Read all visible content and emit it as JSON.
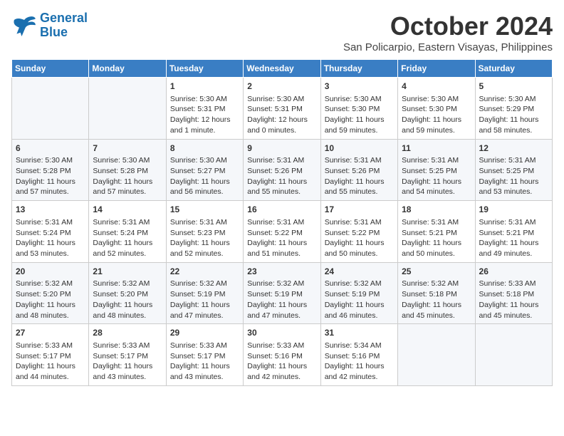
{
  "logo": {
    "line1": "General",
    "line2": "Blue"
  },
  "title": "October 2024",
  "subtitle": "San Policarpio, Eastern Visayas, Philippines",
  "weekdays": [
    "Sunday",
    "Monday",
    "Tuesday",
    "Wednesday",
    "Thursday",
    "Friday",
    "Saturday"
  ],
  "weeks": [
    [
      {
        "day": null,
        "info": null
      },
      {
        "day": null,
        "info": null
      },
      {
        "day": "1",
        "info": "Sunrise: 5:30 AM\nSunset: 5:31 PM\nDaylight: 12 hours\nand 1 minute."
      },
      {
        "day": "2",
        "info": "Sunrise: 5:30 AM\nSunset: 5:31 PM\nDaylight: 12 hours\nand 0 minutes."
      },
      {
        "day": "3",
        "info": "Sunrise: 5:30 AM\nSunset: 5:30 PM\nDaylight: 11 hours\nand 59 minutes."
      },
      {
        "day": "4",
        "info": "Sunrise: 5:30 AM\nSunset: 5:30 PM\nDaylight: 11 hours\nand 59 minutes."
      },
      {
        "day": "5",
        "info": "Sunrise: 5:30 AM\nSunset: 5:29 PM\nDaylight: 11 hours\nand 58 minutes."
      }
    ],
    [
      {
        "day": "6",
        "info": "Sunrise: 5:30 AM\nSunset: 5:28 PM\nDaylight: 11 hours\nand 57 minutes."
      },
      {
        "day": "7",
        "info": "Sunrise: 5:30 AM\nSunset: 5:28 PM\nDaylight: 11 hours\nand 57 minutes."
      },
      {
        "day": "8",
        "info": "Sunrise: 5:30 AM\nSunset: 5:27 PM\nDaylight: 11 hours\nand 56 minutes."
      },
      {
        "day": "9",
        "info": "Sunrise: 5:31 AM\nSunset: 5:26 PM\nDaylight: 11 hours\nand 55 minutes."
      },
      {
        "day": "10",
        "info": "Sunrise: 5:31 AM\nSunset: 5:26 PM\nDaylight: 11 hours\nand 55 minutes."
      },
      {
        "day": "11",
        "info": "Sunrise: 5:31 AM\nSunset: 5:25 PM\nDaylight: 11 hours\nand 54 minutes."
      },
      {
        "day": "12",
        "info": "Sunrise: 5:31 AM\nSunset: 5:25 PM\nDaylight: 11 hours\nand 53 minutes."
      }
    ],
    [
      {
        "day": "13",
        "info": "Sunrise: 5:31 AM\nSunset: 5:24 PM\nDaylight: 11 hours\nand 53 minutes."
      },
      {
        "day": "14",
        "info": "Sunrise: 5:31 AM\nSunset: 5:24 PM\nDaylight: 11 hours\nand 52 minutes."
      },
      {
        "day": "15",
        "info": "Sunrise: 5:31 AM\nSunset: 5:23 PM\nDaylight: 11 hours\nand 52 minutes."
      },
      {
        "day": "16",
        "info": "Sunrise: 5:31 AM\nSunset: 5:22 PM\nDaylight: 11 hours\nand 51 minutes."
      },
      {
        "day": "17",
        "info": "Sunrise: 5:31 AM\nSunset: 5:22 PM\nDaylight: 11 hours\nand 50 minutes."
      },
      {
        "day": "18",
        "info": "Sunrise: 5:31 AM\nSunset: 5:21 PM\nDaylight: 11 hours\nand 50 minutes."
      },
      {
        "day": "19",
        "info": "Sunrise: 5:31 AM\nSunset: 5:21 PM\nDaylight: 11 hours\nand 49 minutes."
      }
    ],
    [
      {
        "day": "20",
        "info": "Sunrise: 5:32 AM\nSunset: 5:20 PM\nDaylight: 11 hours\nand 48 minutes."
      },
      {
        "day": "21",
        "info": "Sunrise: 5:32 AM\nSunset: 5:20 PM\nDaylight: 11 hours\nand 48 minutes."
      },
      {
        "day": "22",
        "info": "Sunrise: 5:32 AM\nSunset: 5:19 PM\nDaylight: 11 hours\nand 47 minutes."
      },
      {
        "day": "23",
        "info": "Sunrise: 5:32 AM\nSunset: 5:19 PM\nDaylight: 11 hours\nand 47 minutes."
      },
      {
        "day": "24",
        "info": "Sunrise: 5:32 AM\nSunset: 5:19 PM\nDaylight: 11 hours\nand 46 minutes."
      },
      {
        "day": "25",
        "info": "Sunrise: 5:32 AM\nSunset: 5:18 PM\nDaylight: 11 hours\nand 45 minutes."
      },
      {
        "day": "26",
        "info": "Sunrise: 5:33 AM\nSunset: 5:18 PM\nDaylight: 11 hours\nand 45 minutes."
      }
    ],
    [
      {
        "day": "27",
        "info": "Sunrise: 5:33 AM\nSunset: 5:17 PM\nDaylight: 11 hours\nand 44 minutes."
      },
      {
        "day": "28",
        "info": "Sunrise: 5:33 AM\nSunset: 5:17 PM\nDaylight: 11 hours\nand 43 minutes."
      },
      {
        "day": "29",
        "info": "Sunrise: 5:33 AM\nSunset: 5:17 PM\nDaylight: 11 hours\nand 43 minutes."
      },
      {
        "day": "30",
        "info": "Sunrise: 5:33 AM\nSunset: 5:16 PM\nDaylight: 11 hours\nand 42 minutes."
      },
      {
        "day": "31",
        "info": "Sunrise: 5:34 AM\nSunset: 5:16 PM\nDaylight: 11 hours\nand 42 minutes."
      },
      {
        "day": null,
        "info": null
      },
      {
        "day": null,
        "info": null
      }
    ]
  ]
}
